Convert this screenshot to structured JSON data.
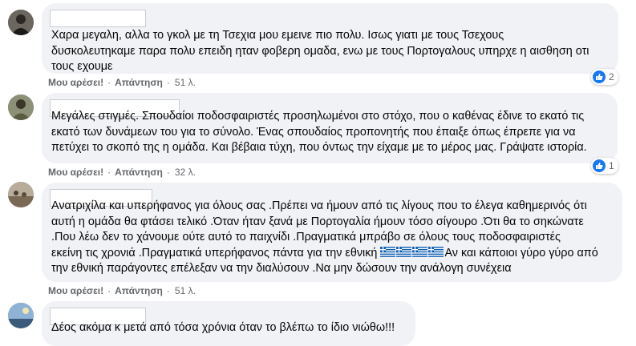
{
  "comments": [
    {
      "text": "Χαρα μεγαλη, αλλα το γκολ με τη Τσεχια μου εμεινε πιο πολυ. Ισως γιατι με τους Τσεχους\nδυσκολευτηκαμε παρα πολυ επειδη ηταν φοβερη ομαδα, ενω με τους Πορτογαλους υπηρχε η αισθηση οτι\nτους εχουμε",
      "like_label": "Μου αρέσει!",
      "reply_label": "Απάντηση",
      "time": "51 λ.",
      "reaction_count": "2"
    },
    {
      "text": "Μεγάλες στιγμές. Σπουδαίοι ποδοσφαιριστές προσηλωμένοι στο στόχο, που ο καθένας έδινε το εκατό τις\nεκατό των δυνάμεων του για το σύνολο. Ένας σπουδαίος προπονητής που έπαιξε όπως έπρεπε για να\nπετύχει το σκοπό της η ομάδα. Και βέβαια τύχη, που όντως την είχαμε με το μέρος μας. Γράψατε ιστορία.",
      "like_label": "Μου αρέσει!",
      "reply_label": "Απάντηση",
      "time": "32 λ.",
      "reaction_count": "1"
    },
    {
      "text_part1": "Ανατριχίλα και υπερήφανος για όλους σας .Πρέπει να ήμουν από τις λίγους που το έλεγα καθημερινός ότι\nαυτή η ομάδα θα φτάσει τελικό .Όταν ήταν ξανά με Πορτογαλία ήμουν τόσο σίγουρο .Ότι θα το σηκώνατε\n.Που λέω δεν το χάνουμε ούτε αυτό το παιχνίδι .Πραγματικά μπράβο σε όλους τους ποδοσφαιριστές\nεκείνη τις χρονιά .Πραγματικά υπερήφανος πάντα για την εθνική ",
      "text_part2": "Αν και κάποιοι γύρο γύρο από\nτην εθνική παράγοντες επέλεξαν να την διαλύσουν .Να μην δώσουν την ανάλογη συνέχεια",
      "like_label": "Μου αρέσει!",
      "reply_label": "Απάντηση",
      "time": "51 λ."
    },
    {
      "text": "Δέος ακόμα κ μετά από τόσα χρόνια όταν το βλέπω το ίδιο νιώθω!!!"
    }
  ]
}
